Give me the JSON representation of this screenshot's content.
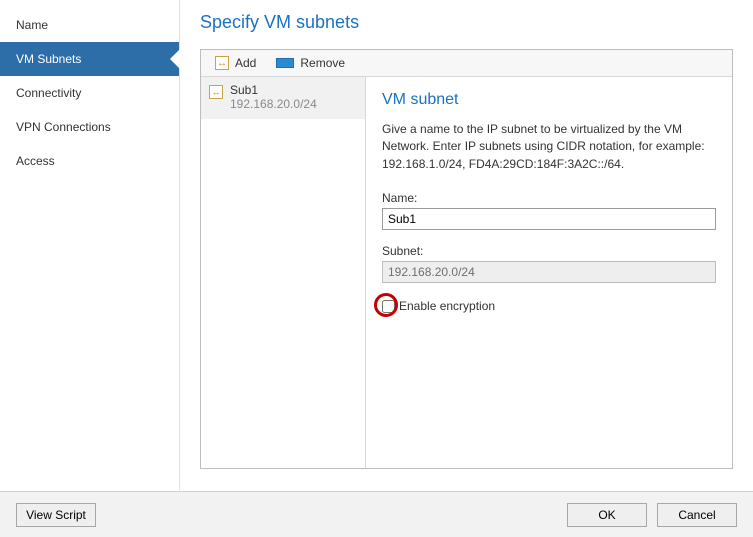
{
  "sidebar": {
    "items": [
      {
        "label": "Name"
      },
      {
        "label": "VM Subnets"
      },
      {
        "label": "Connectivity"
      },
      {
        "label": "VPN Connections"
      },
      {
        "label": "Access"
      }
    ],
    "selected_index": 1
  },
  "page": {
    "title": "Specify VM subnets"
  },
  "toolbar": {
    "add_label": "Add",
    "remove_label": "Remove"
  },
  "subnet_list": [
    {
      "name": "Sub1",
      "cidr": "192.168.20.0/24",
      "icon": "subnet-icon"
    }
  ],
  "detail": {
    "title": "VM subnet",
    "description": "Give a name to the IP subnet to be virtualized by the VM Network. Enter IP subnets using CIDR notation, for example: 192.168.1.0/24, FD4A:29CD:184F:3A2C::/64.",
    "name_label": "Name:",
    "name_value": "Sub1",
    "subnet_label": "Subnet:",
    "subnet_value": "192.168.20.0/24",
    "encryption_label": "Enable encryption",
    "encryption_checked": false
  },
  "footer": {
    "view_script": "View Script",
    "ok": "OK",
    "cancel": "Cancel"
  }
}
